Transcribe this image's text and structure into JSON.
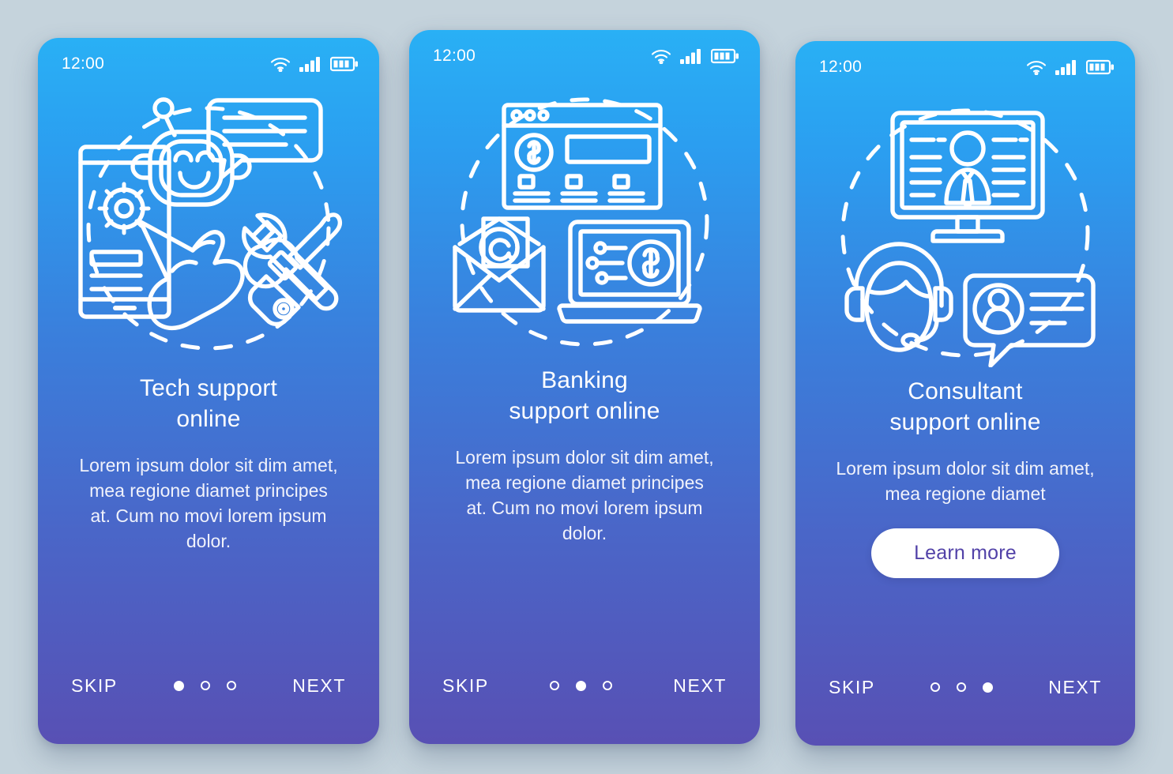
{
  "page": {
    "background_color": "#c5d3dc",
    "gradient_top": "#29b0f5",
    "gradient_bottom": "#5850b4"
  },
  "screens": [
    {
      "status_bar": {
        "time": "12:00",
        "icons": [
          "wifi-icon",
          "signal-icon",
          "battery-icon"
        ]
      },
      "illustration": {
        "name": "tech-support-illustration",
        "elements": [
          "tablet-with-gear",
          "pointing-hand",
          "chatbot-robot",
          "speech-bubble",
          "wrench",
          "screwdriver",
          "dashed-circle"
        ]
      },
      "title": "Tech support\nonline",
      "body": "Lorem ipsum dolor sit dim amet, mea regione diamet principes at. Cum no movi lorem ipsum dolor.",
      "cta": null,
      "nav": {
        "skip_label": "SKIP",
        "next_label": "NEXT",
        "dots_total": 3,
        "dot_active_index": 0
      }
    },
    {
      "status_bar": {
        "time": "12:00",
        "icons": [
          "wifi-icon",
          "signal-icon",
          "battery-icon"
        ]
      },
      "illustration": {
        "name": "banking-support-illustration",
        "elements": [
          "browser-window",
          "dollar-coin",
          "email-envelope-at",
          "laptop-with-dollar",
          "network-nodes",
          "dashed-circle"
        ]
      },
      "title": "Banking\nsupport online",
      "body": "Lorem ipsum dolor sit dim amet, mea regione diamet principes at. Cum no movi lorem ipsum dolor.",
      "cta": null,
      "nav": {
        "skip_label": "SKIP",
        "next_label": "NEXT",
        "dots_total": 3,
        "dot_active_index": 1
      }
    },
    {
      "status_bar": {
        "time": "12:00",
        "icons": [
          "wifi-icon",
          "signal-icon",
          "battery-icon"
        ]
      },
      "illustration": {
        "name": "consultant-support-illustration",
        "elements": [
          "desktop-monitor",
          "businessman-avatar",
          "headset-operator",
          "chat-bubble-avatar",
          "dashed-circle"
        ]
      },
      "title": "Consultant\nsupport online",
      "body": "Lorem ipsum dolor sit dim amet, mea regione diamet",
      "cta": {
        "label": "Learn more",
        "text_color": "#5242a8",
        "background": "#ffffff"
      },
      "nav": {
        "skip_label": "SKIP",
        "next_label": "NEXT",
        "dots_total": 3,
        "dot_active_index": 2
      }
    }
  ]
}
